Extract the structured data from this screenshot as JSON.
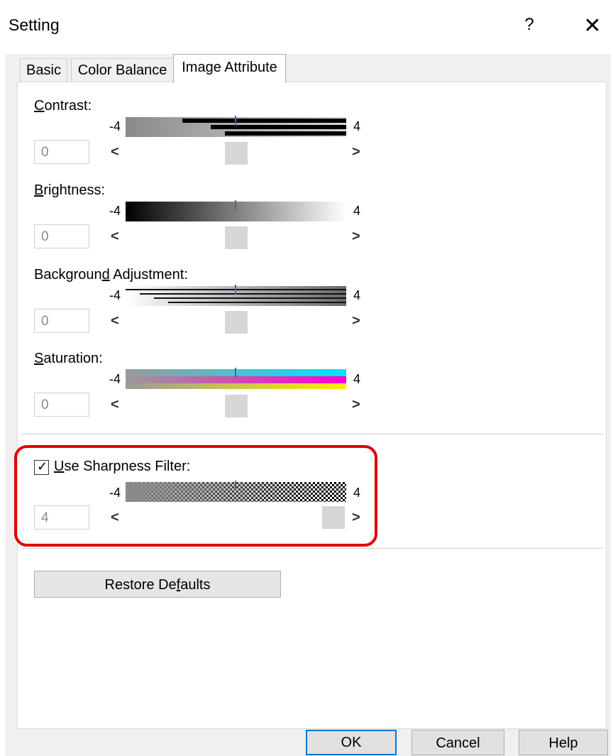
{
  "window": {
    "title": "Setting",
    "help_glyph": "?",
    "close_glyph": "✕"
  },
  "tabs": [
    {
      "label": "Basic",
      "selected": false
    },
    {
      "label": "Color Balance",
      "selected": false
    },
    {
      "label": "Image Attribute",
      "selected": true
    }
  ],
  "controls": {
    "contrast": {
      "label_prefix": "",
      "label_accel": "C",
      "label_rest": "ontrast:",
      "min": "-4",
      "max": "4",
      "value": "0"
    },
    "brightness": {
      "label_prefix": "",
      "label_accel": "B",
      "label_rest": "rightness:",
      "min": "-4",
      "max": "4",
      "value": "0"
    },
    "background": {
      "label_prefix": "Backgroun",
      "label_accel": "d",
      "label_rest": " Adjustment:",
      "min": "-4",
      "max": "4",
      "value": "0"
    },
    "saturation": {
      "label_prefix": "",
      "label_accel": "S",
      "label_rest": "aturation:",
      "min": "-4",
      "max": "4",
      "value": "0"
    },
    "sharpness": {
      "label_prefix": "",
      "label_accel": "U",
      "label_rest": "se Sharpness Filter:",
      "min": "-4",
      "max": "4",
      "value": "4",
      "checked": true
    }
  },
  "arrows": {
    "left": "<",
    "right": ">"
  },
  "buttons": {
    "restore_prefix": "Restore De",
    "restore_accel": "f",
    "restore_rest": "aults",
    "ok": "OK",
    "cancel": "Cancel",
    "help": "Help"
  },
  "colors": {
    "highlight": "#e00000",
    "default_button_border": "#0078d7"
  }
}
